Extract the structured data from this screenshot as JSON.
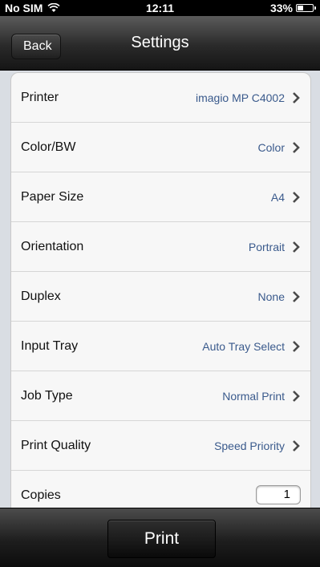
{
  "status_bar": {
    "carrier": "No SIM",
    "time": "12:11",
    "battery": "33%",
    "battery_level": 0.33,
    "wifi_icon": "wifi-icon",
    "battery_icon": "battery-icon"
  },
  "nav": {
    "title": "Settings",
    "back_label": "Back"
  },
  "settings": [
    {
      "label": "Printer",
      "value": "imagio MP C4002"
    },
    {
      "label": "Color/BW",
      "value": "Color"
    },
    {
      "label": "Paper Size",
      "value": "A4"
    },
    {
      "label": "Orientation",
      "value": "Portrait"
    },
    {
      "label": "Duplex",
      "value": "None"
    },
    {
      "label": "Input Tray",
      "value": "Auto Tray Select"
    },
    {
      "label": "Job Type",
      "value": "Normal Print"
    },
    {
      "label": "Print Quality",
      "value": "Speed Priority"
    }
  ],
  "copies": {
    "label": "Copies",
    "value": "1"
  },
  "toolbar": {
    "print_label": "Print"
  },
  "colors": {
    "value_text": "#3a5a8c",
    "background": "#d9dde3"
  }
}
